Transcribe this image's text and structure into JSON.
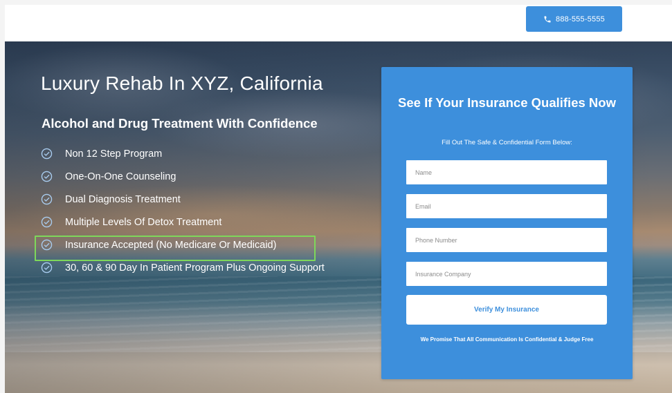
{
  "header": {
    "phone_label": "888-555-5555",
    "phone_icon": "phone-icon",
    "accent_color": "#3d8fdc"
  },
  "hero": {
    "headline": "Luxury Rehab In XYZ, California",
    "subheadline": "Alcohol and Drug Treatment With Confidence",
    "features": [
      "Non 12 Step Program",
      "One-On-One Counseling",
      "Dual Diagnosis Treatment",
      "Multiple Levels Of Detox Treatment",
      "Insurance Accepted (No Medicare Or Medicaid)",
      "30, 60 & 90 Day In Patient Program Plus Ongoing Support"
    ],
    "feature_icon": "check-circle-icon",
    "highlight_color": "#7ed85a"
  },
  "form": {
    "title": "See If Your Insurance Qualifies Now",
    "subtitle": "Fill Out The Safe & Confidential Form Below:",
    "name_placeholder": "Name",
    "email_placeholder": "Email",
    "phone_placeholder": "Phone Number",
    "insurance_placeholder": "Insurance Company",
    "submit_label": "Verify My Insurance",
    "footer_note": "We Promise That All Communication Is Confidential & Judge Free"
  }
}
